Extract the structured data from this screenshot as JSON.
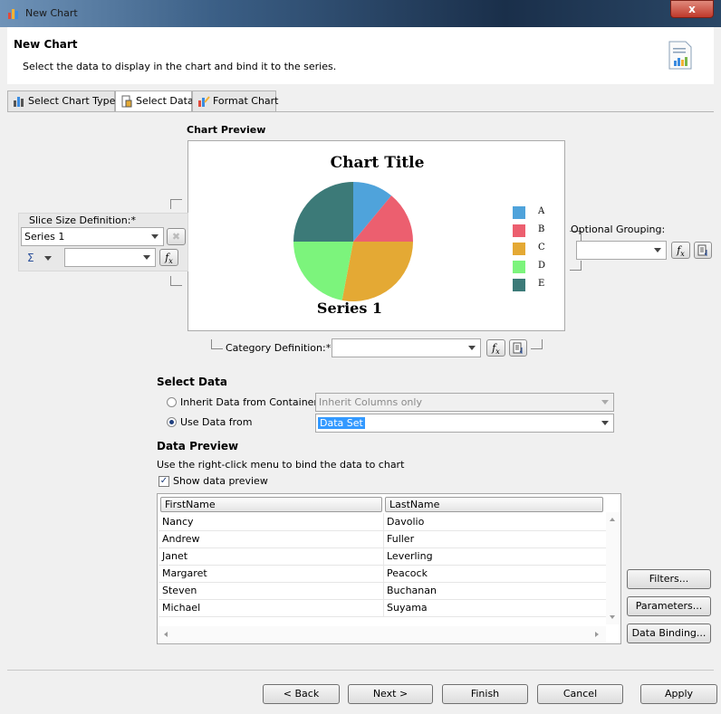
{
  "window": {
    "title": "New Chart",
    "close_label": "x"
  },
  "header": {
    "title": "New Chart",
    "subtitle": "Select the data to display in the chart and bind it to the series."
  },
  "tabs": [
    {
      "label": "Select Chart Type",
      "active": false
    },
    {
      "label": "Select Data",
      "active": true
    },
    {
      "label": "Format Chart",
      "active": false
    }
  ],
  "chart_preview": {
    "label": "Chart Preview",
    "chart_data": {
      "type": "pie",
      "title": "Chart Title",
      "series": [
        {
          "name": "Series 1",
          "labels": [
            "A",
            "B",
            "C",
            "D",
            "E"
          ],
          "values": [
            11,
            14,
            28,
            22,
            25
          ]
        }
      ],
      "colors": [
        "#4fa3db",
        "#ec5f6f",
        "#e4a934",
        "#7cf47c",
        "#3c7a78"
      ],
      "legend_position": "right"
    }
  },
  "slice_size": {
    "label": "Slice Size Definition:*",
    "series_value": "Series 1",
    "sigma": "Σ"
  },
  "optional_grouping": {
    "label": "Optional Grouping:"
  },
  "category": {
    "label": "Category Definition:*"
  },
  "select_data": {
    "heading": "Select Data",
    "inherit_label": "Inherit Data from Container",
    "inherit_combo": "Inherit Columns only",
    "use_label": "Use Data from",
    "use_combo": "Data Set"
  },
  "data_preview": {
    "heading": "Data Preview",
    "hint": "Use the right-click menu to bind the data to chart",
    "show_label": "Show data preview",
    "columns": [
      "FirstName",
      "LastName"
    ],
    "rows": [
      [
        "Nancy",
        "Davolio"
      ],
      [
        "Andrew",
        "Fuller"
      ],
      [
        "Janet",
        "Leverling"
      ],
      [
        "Margaret",
        "Peacock"
      ],
      [
        "Steven",
        "Buchanan"
      ],
      [
        "Michael",
        "Suyama"
      ]
    ]
  },
  "side_buttons": {
    "filters": "Filters...",
    "parameters": "Parameters...",
    "binding": "Data Binding..."
  },
  "footer": {
    "back": "< Back",
    "next": "Next >",
    "finish": "Finish",
    "cancel": "Cancel",
    "apply": "Apply"
  }
}
